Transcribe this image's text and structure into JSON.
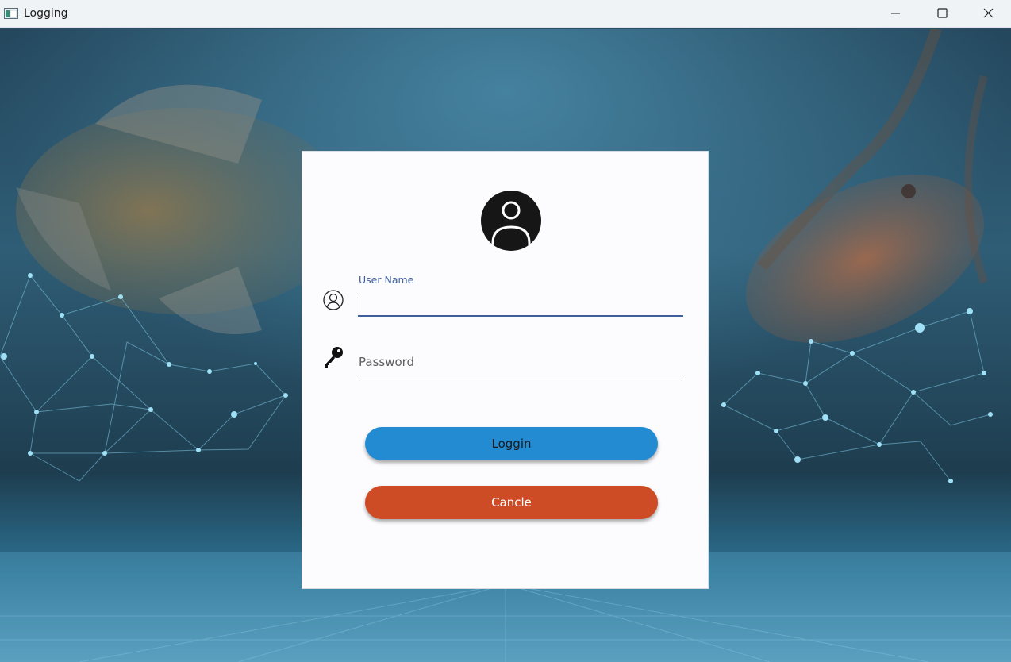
{
  "window": {
    "title": "Logging",
    "icons": {
      "app": "app-window-icon",
      "minimize": "minimize-icon",
      "maximize": "maximize-icon",
      "close": "close-icon"
    }
  },
  "login": {
    "avatar_icon": "user-avatar-icon",
    "username": {
      "label": "User Name",
      "value": "",
      "icon": "user-circle-icon"
    },
    "password": {
      "placeholder": "Password",
      "value": "",
      "icon": "key-icon"
    },
    "login_button": "Loggin",
    "cancel_button": "Cancle"
  },
  "colors": {
    "login_button": "#238bd2",
    "cancel_button": "#cd4b25",
    "field_accent": "#3f5e9c"
  }
}
